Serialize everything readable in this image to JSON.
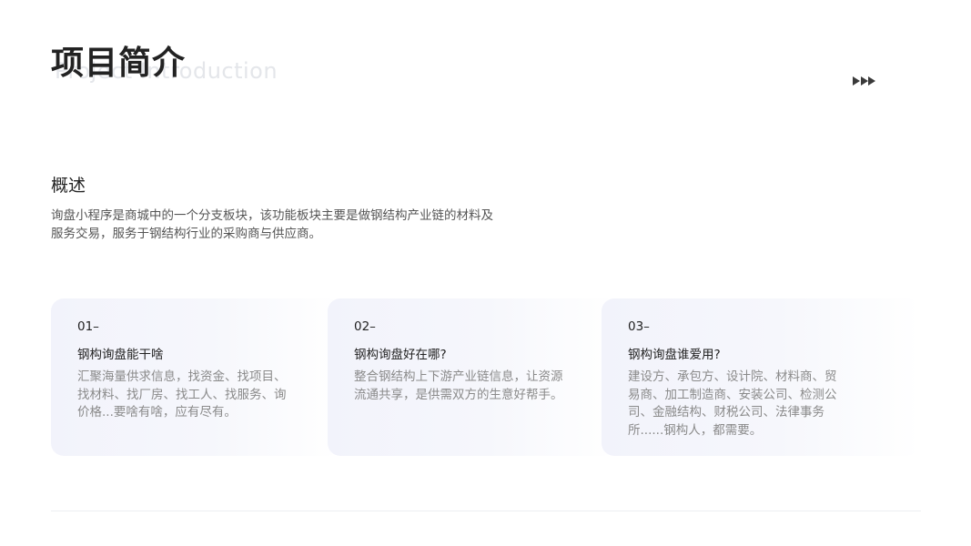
{
  "header": {
    "title": "项目简介",
    "subtitle": "Project Introduction",
    "arrows_icon": "triple-play-arrow-icon"
  },
  "overview": {
    "heading": "概述",
    "description": "询盘小程序是商城中的一个分支板块，该功能板块主要是做钢结构产业链的材料及服务交易，服务于钢结构行业的采购商与供应商。"
  },
  "cards": [
    {
      "number": "01–",
      "title": "钢构询盘能干啥",
      "body": "汇聚海量供求信息，找资金、找项目、找材料、找厂房、找工人、找服务、询价格...要啥有啥，应有尽有。"
    },
    {
      "number": "02–",
      "title": "钢构询盘好在哪?",
      "body": "整合钢结构上下游产业链信息，让资源流通共享，是供需双方的生意好帮手。"
    },
    {
      "number": "03–",
      "title": "钢构询盘谁爱用?",
      "body": "建设方、承包方、设计院、材料商、贸易商、加工制造商、安装公司、检测公司、金融结构、财税公司、法律事务所......钢构人，都需要。"
    }
  ],
  "colors": {
    "text_primary": "#222222",
    "text_secondary": "#555555",
    "text_muted": "#8a8a8a",
    "watermark": "#e4e6ea",
    "card_bg": "#f2f3fb"
  }
}
